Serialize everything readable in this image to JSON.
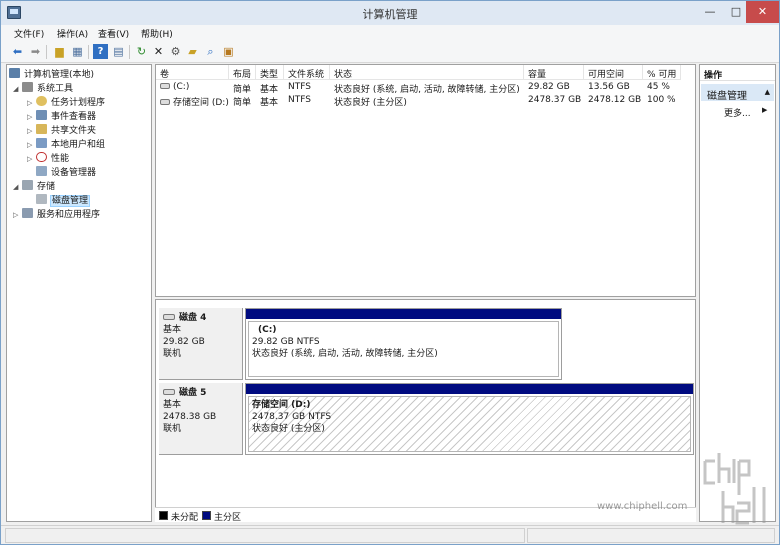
{
  "window": {
    "title": "计算机管理"
  },
  "window_controls": {
    "minimize": "—",
    "maximize": "□",
    "close": "✕"
  },
  "menu": [
    "文件(F)",
    "操作(A)",
    "查看(V)",
    "帮助(H)"
  ],
  "toolbar_icons": [
    "back-icon",
    "forward-icon",
    "up-folder-icon",
    "show-hide-tree-icon",
    "help-icon",
    "properties-icon",
    "refresh-icon",
    "delete-icon",
    "settings-icon",
    "open-folder-icon",
    "search-icon",
    "export-icon"
  ],
  "tree": {
    "root": "计算机管理(本地)",
    "system_tools": "系统工具",
    "task_scheduler": "任务计划程序",
    "event_viewer": "事件查看器",
    "shared_folders": "共享文件夹",
    "local_users": "本地用户和组",
    "performance": "性能",
    "device_manager": "设备管理器",
    "storage": "存储",
    "disk_management": "磁盘管理",
    "services": "服务和应用程序"
  },
  "volume_table": {
    "headers": [
      "卷",
      "布局",
      "类型",
      "文件系统",
      "状态",
      "容量",
      "可用空间",
      "% 可用"
    ],
    "rows": [
      [
        "(C:)",
        "简单",
        "基本",
        "NTFS",
        "状态良好 (系统, 启动, 活动, 故障转储, 主分区)",
        "29.82 GB",
        "13.56 GB",
        "45 %"
      ],
      [
        "存储空间 (D:)",
        "简单",
        "基本",
        "NTFS",
        "状态良好 (主分区)",
        "2478.37 GB",
        "2478.12 GB",
        "100 %"
      ]
    ]
  },
  "disks": [
    {
      "name": "磁盘 4",
      "type": "基本",
      "size": "29.82 GB",
      "status": "联机",
      "partition": {
        "name": "(C:)",
        "size": "29.82 GB NTFS",
        "status": "状态良好 (系统, 启动, 活动, 故障转储, 主分区)"
      }
    },
    {
      "name": "磁盘 5",
      "type": "基本",
      "size": "2478.38 GB",
      "status": "联机",
      "partition": {
        "name": "存储空间  (D:)",
        "size": "2478.37 GB NTFS",
        "status": "状态良好 (主分区)"
      }
    }
  ],
  "legend": {
    "unallocated": "未分配",
    "primary": "主分区",
    "unallocated_color": "#000000",
    "primary_color": "#000b80"
  },
  "actions": {
    "title": "操作",
    "section": "磁盘管理",
    "more": "更多..."
  },
  "watermark": {
    "url": "www.chiphell.com"
  },
  "colors": {
    "partition_header": "#000b80",
    "selection": "#cce8ff",
    "close_button": "#c74b4b"
  }
}
